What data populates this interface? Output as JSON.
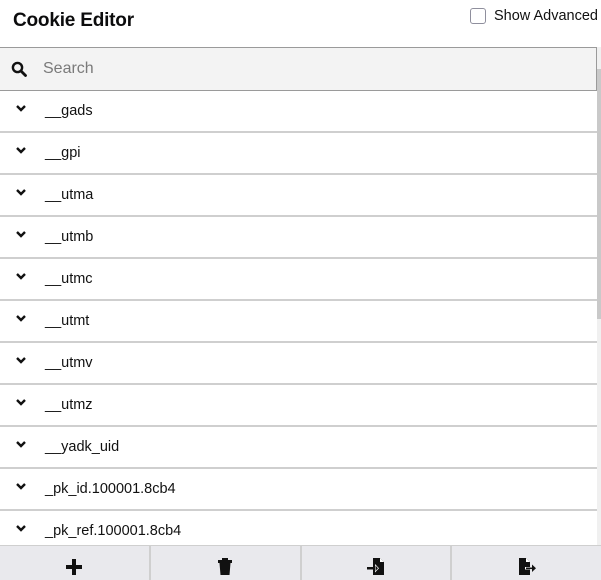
{
  "header": {
    "title": "Cookie Editor",
    "show_advanced_label": "Show Advanced",
    "show_advanced_checked": false
  },
  "search": {
    "placeholder": "Search",
    "value": "",
    "icon": "search-icon"
  },
  "cookies": [
    {
      "name": "__gads"
    },
    {
      "name": "__gpi"
    },
    {
      "name": "__utma"
    },
    {
      "name": "__utmb"
    },
    {
      "name": "__utmc"
    },
    {
      "name": "__utmt"
    },
    {
      "name": "__utmv"
    },
    {
      "name": "__utmz"
    },
    {
      "name": "__yadk_uid"
    },
    {
      "name": "_pk_id.100001.8cb4"
    },
    {
      "name": "_pk_ref.100001.8cb4"
    }
  ],
  "toolbar": {
    "buttons": [
      {
        "action": "add",
        "icon": "plus-icon"
      },
      {
        "action": "delete-all",
        "icon": "trash-icon"
      },
      {
        "action": "import",
        "icon": "file-import-icon"
      },
      {
        "action": "export",
        "icon": "file-export-icon"
      }
    ]
  }
}
